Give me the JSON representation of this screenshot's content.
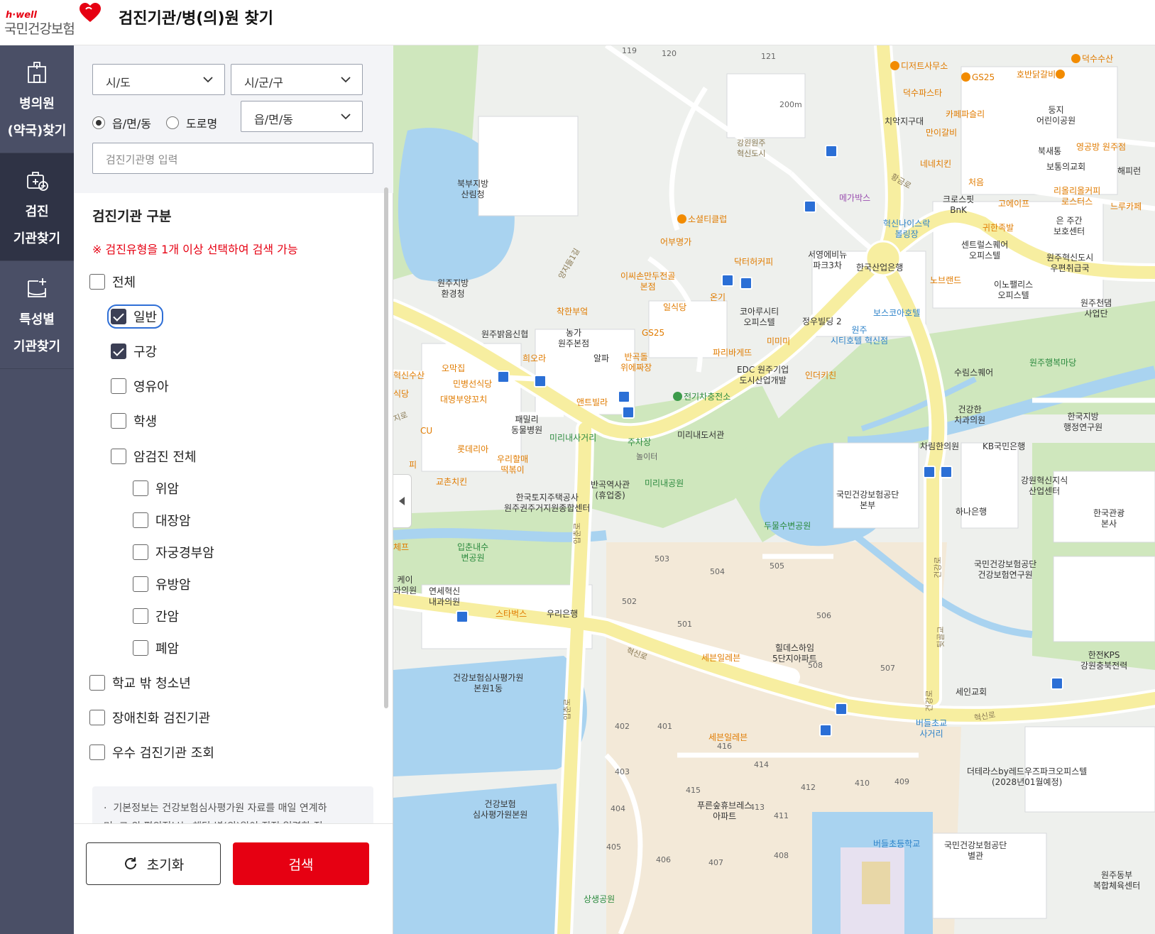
{
  "header": {
    "logo_hwell": "h·well",
    "logo_brand": "국민건강보험",
    "title": "검진기관/병(의)원 찾기"
  },
  "nav": [
    {
      "line1": "병의원",
      "line2": "(약국)찾기",
      "icon": "hospital-building-icon",
      "active": false
    },
    {
      "line1": "검진",
      "line2": "기관찾기",
      "icon": "medical-kit-icon",
      "active": true
    },
    {
      "line1": "특성별",
      "line2": "기관찾기",
      "icon": "clipboard-plus-icon",
      "active": false
    }
  ],
  "filters": {
    "sido": "시/도",
    "sigungu": "시/군/구",
    "radio_eup": "읍/면/동",
    "radio_road": "도로명",
    "eupmyeondong": "읍/면/동",
    "name_placeholder": "검진기관명 입력"
  },
  "category": {
    "title": "검진기관 구분",
    "notice": "※ 검진유형을 1개 이상 선택하여 검색 가능",
    "items": [
      {
        "label": "전체",
        "checked": false
      },
      {
        "label": "일반",
        "checked": true
      },
      {
        "label": "구강",
        "checked": true
      },
      {
        "label": "영유아",
        "checked": false
      },
      {
        "label": "학생",
        "checked": false
      },
      {
        "label": "암검진 전체",
        "checked": false
      },
      {
        "label": "위암",
        "checked": false
      },
      {
        "label": "대장암",
        "checked": false
      },
      {
        "label": "자궁경부암",
        "checked": false
      },
      {
        "label": "유방암",
        "checked": false
      },
      {
        "label": "간암",
        "checked": false
      },
      {
        "label": "폐암",
        "checked": false
      },
      {
        "label": "학교 밖 청소년",
        "checked": false
      },
      {
        "label": "장애친화 검진기관",
        "checked": false
      },
      {
        "label": "우수 검진기관 조회",
        "checked": false
      }
    ]
  },
  "info": {
    "line1": "기본정보는 건강보험심사평가원 자료를 매일 연계하",
    "line2": "며, 그 외 편의정보는 해당 병(의)원이 직접 입력한 정"
  },
  "buttons": {
    "reset": "초기화",
    "search": "검색"
  },
  "map": {
    "pois": {
      "p1": "디저트사무소",
      "p2": "GS25",
      "p3": "호반닭갈비",
      "p4": "덕수수산",
      "p5": "덕수파스타",
      "p6": "치악지구대",
      "p7": "카페파슬리",
      "p8": "만이갈비",
      "p9": "둥지\n어린이공원",
      "p10": "북새통",
      "p11": "영공방 원주점",
      "p12": "보통의교회",
      "p13": "해피런",
      "p14": "강원원주\n혁신도시",
      "p15": "200m",
      "p16": "네네치킨",
      "p17": "처음",
      "p18": "크로스핏\nBnK",
      "p19": "고에이프",
      "p20": "리올리올커피\n로스터스",
      "p21": "느루카페",
      "p22": "북부지방\n산림청",
      "p23": "메가박스",
      "p24": "혁신나이스락\n볼링장",
      "p25": "소셜티클럽",
      "p26": "귀한족발",
      "p27": "은 주간\n보호센터",
      "p28": "센트럴스퀘어\n오피스텔",
      "p29": "원주혁신도시\n우편취급국",
      "p30": "어부명가",
      "p31": "닥터허커피",
      "p32": "서영에비뉴\n파크3차",
      "p33": "한국산업은행",
      "p34": "노브랜드",
      "p35": "이노팰리스\n오피스텔",
      "p36": "원주천댐\n사업단",
      "p37": "원주지방\n환경청",
      "p38": "이씨손만두전골\n본점",
      "p39": "온기",
      "p40": "일식당",
      "p41": "착한부엌",
      "p42": "코아루시티\n오피스텔",
      "p43": "정우빌딩 2",
      "p44": "보스코아호텔",
      "p45": "원주밝음신협",
      "p46": "농가\n원주본점",
      "p47": "GS25",
      "p48": "파리바게뜨",
      "p49": "미미미",
      "p50": "원주\n시티호텔 혁신점",
      "p51": "희오라",
      "p52": "알파",
      "p53": "반곡돌\n위에짜장",
      "p54": "EDC 원주기업\n도시산업개발",
      "p55": "인더키친",
      "p56": "원주행복마당",
      "p57": "수림스퀘어",
      "p58": "혁신수산",
      "p59": "오막집",
      "p60": "민병선식당",
      "p61": "식당",
      "p62": "대명부양꼬치",
      "p63": "앤트빌라",
      "p64": "전기차충전소",
      "p65": "건강한\n치과의원",
      "p66": "한국지방\n행정연구원",
      "p67": "CU",
      "p68": "패밀리\n동물병원",
      "p69": "미리내사거리",
      "p70": "주차장",
      "p71": "미리내도서관",
      "p72": "롯데리아",
      "p73": "놀이터",
      "p74": "차림한의원",
      "p75": "KB국민은행",
      "p76": "우리할매\n떡볶이",
      "p77": "피",
      "p78": "교촌치킨",
      "p79": "반곡역사관\n(휴업중)",
      "p80": "미리내공원",
      "p81": "국민건강보험공단\n본부",
      "p82": "강원혁신지식\n산업센터",
      "p83": "한국토지주택공사\n원주권주거지원종합센터",
      "p84": "하나은행",
      "p85": "한국관광\n본사",
      "p86": "두물수변공원",
      "p87": "입춘내수\n변공원",
      "p88": "체프",
      "p89": "국민건강보험공단\n건강보험연구원",
      "p90": "케이\n과의원",
      "p91": "연세혁신\n내과의원",
      "p92": "스타벅스",
      "p93": "우리은행",
      "p94": "세븐일레븐",
      "p95": "힐데스하임\n5단지아파트",
      "p96": "한전KPS\n강원충북전력",
      "p97": "세인교회",
      "p98": "건강보험심사평가원\n본원1동",
      "p99": "버들초교\n사거리",
      "p100": "세븐일레븐",
      "p101": "더테라스by레드우즈파크오피스텔\n(2028년01월예정)",
      "p102": "푸른숲휴브레스\n아파트",
      "p103": "건강보험\n심사평가원본원",
      "p104": "버들초등학교",
      "p105": "국민건강보험공단\n별관",
      "p106": "원주동부\n복합체육센터",
      "p107": "상생공원"
    },
    "roads": {
      "r1": "황금로",
      "r2": "양지들1길",
      "r3": "입춘로",
      "r4": "혁신로",
      "r5": "건강로",
      "r6": "뒷골교",
      "r7": "입춘로",
      "r8": "건강로",
      "r9": "혁신로",
      "r10": "지로"
    },
    "numbers": {
      "n1": "119",
      "n2": "120",
      "n3": "121",
      "n4": "503",
      "n5": "504",
      "n6": "505",
      "n7": "502",
      "n8": "501",
      "n9": "506",
      "n10": "508",
      "n11": "507",
      "n12": "402",
      "n13": "401",
      "n14": "416",
      "n15": "414",
      "n16": "403",
      "n17": "415",
      "n18": "413",
      "n19": "412",
      "n20": "410",
      "n21": "409",
      "n22": "404",
      "n23": "411",
      "n24": "405",
      "n25": "406",
      "n26": "407",
      "n27": "408"
    }
  },
  "colors": {
    "brand_red": "#e60012",
    "nav_bg": "#4a4f66",
    "nav_active": "#2f3345",
    "map_road": "#f7eea0",
    "map_water": "#a9d3f0",
    "map_park": "#cfe7bd"
  }
}
